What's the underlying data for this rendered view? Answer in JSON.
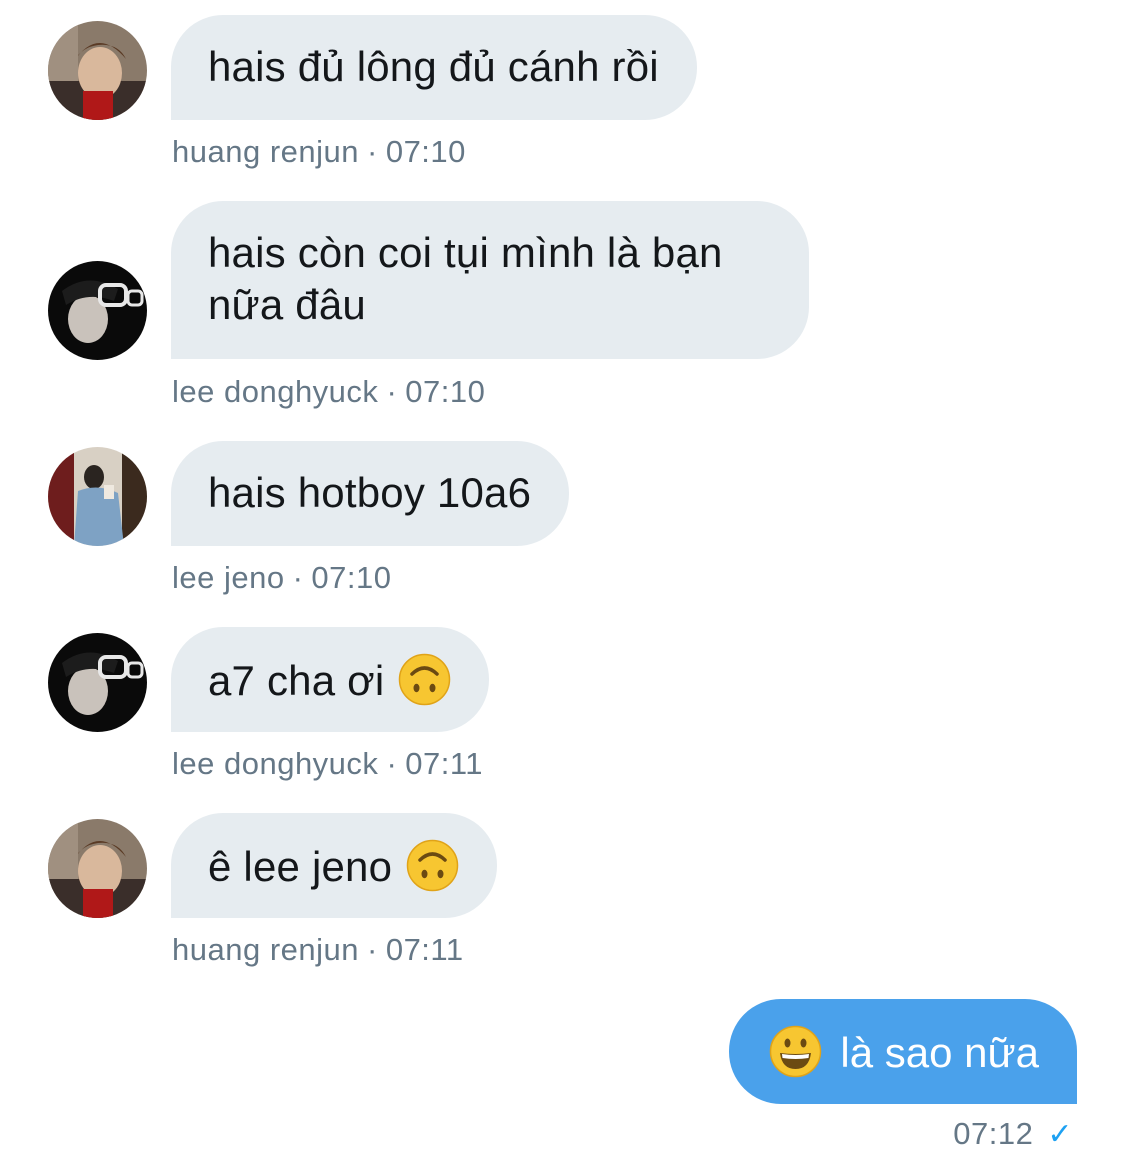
{
  "messages": [
    {
      "text": "hais đủ lông đủ cánh rồi",
      "sender": "huang renjun",
      "time": "07:10",
      "avatar": "avatar-huang-renjun"
    },
    {
      "text": "hais còn coi tụi mình là bạn nữa đâu",
      "sender": "lee donghyuck",
      "time": "07:10",
      "avatar": "avatar-lee-donghyuck"
    },
    {
      "text": "hais hotboy 10a6",
      "sender": "lee jeno",
      "time": "07:10",
      "avatar": "avatar-lee-jeno"
    },
    {
      "text": "a7 cha ơi",
      "emoji": "upside-down-face-icon",
      "sender": "lee donghyuck",
      "time": "07:11",
      "avatar": "avatar-lee-donghyuck"
    },
    {
      "text": "ê lee jeno",
      "emoji": "upside-down-face-icon",
      "sender": "huang renjun",
      "time": "07:11",
      "avatar": "avatar-huang-renjun"
    }
  ],
  "outgoing": {
    "text": "là sao nữa",
    "emoji": "grinning-face-icon",
    "time": "07:12",
    "status_icon": "checkmark-icon"
  },
  "colors": {
    "incoming_bubble": "#e6ecf0",
    "outgoing_bubble": "#4aa1eb",
    "meta_text": "#657786",
    "check": "#1da1f2"
  }
}
